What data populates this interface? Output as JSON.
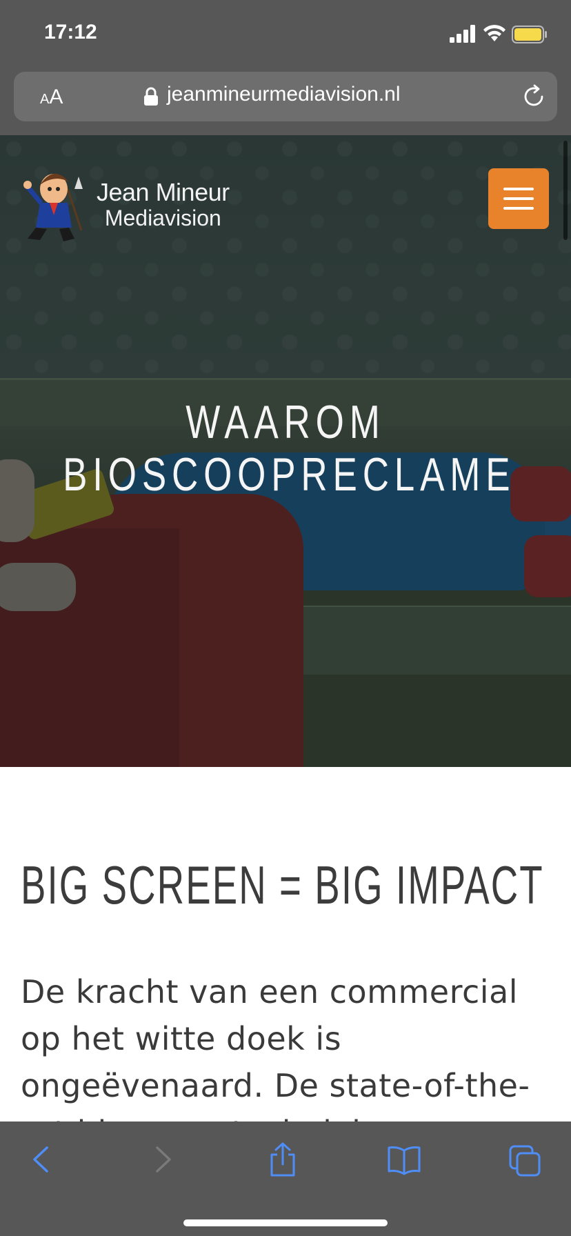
{
  "status_bar": {
    "time": "17:12"
  },
  "browser": {
    "text_size_small": "A",
    "text_size_big": "A",
    "url": "jeanmineurmediavision.nl"
  },
  "header": {
    "logo_line1": "Jean Mineur",
    "logo_line2": "Mediavision"
  },
  "hero": {
    "title_line1": "WAAROM",
    "title_line2": "BIOSCOOPRECLAME"
  },
  "content": {
    "heading": "BIG SCREEN = BIG IMPACT",
    "paragraph": "De kracht van een commercial op het witte doek is ongeëvenaard. De state-of-the-art bioscoop technieken"
  },
  "colors": {
    "menu_button": "#e8832c",
    "system_chrome": "#575757",
    "toolbar_icons": "#4f8ef7",
    "battery": "#f7d94c"
  },
  "icons": {
    "back": "chevron-left-icon",
    "forward": "chevron-right-icon",
    "share": "share-icon",
    "bookmarks": "book-icon",
    "tabs": "tabs-icon"
  }
}
